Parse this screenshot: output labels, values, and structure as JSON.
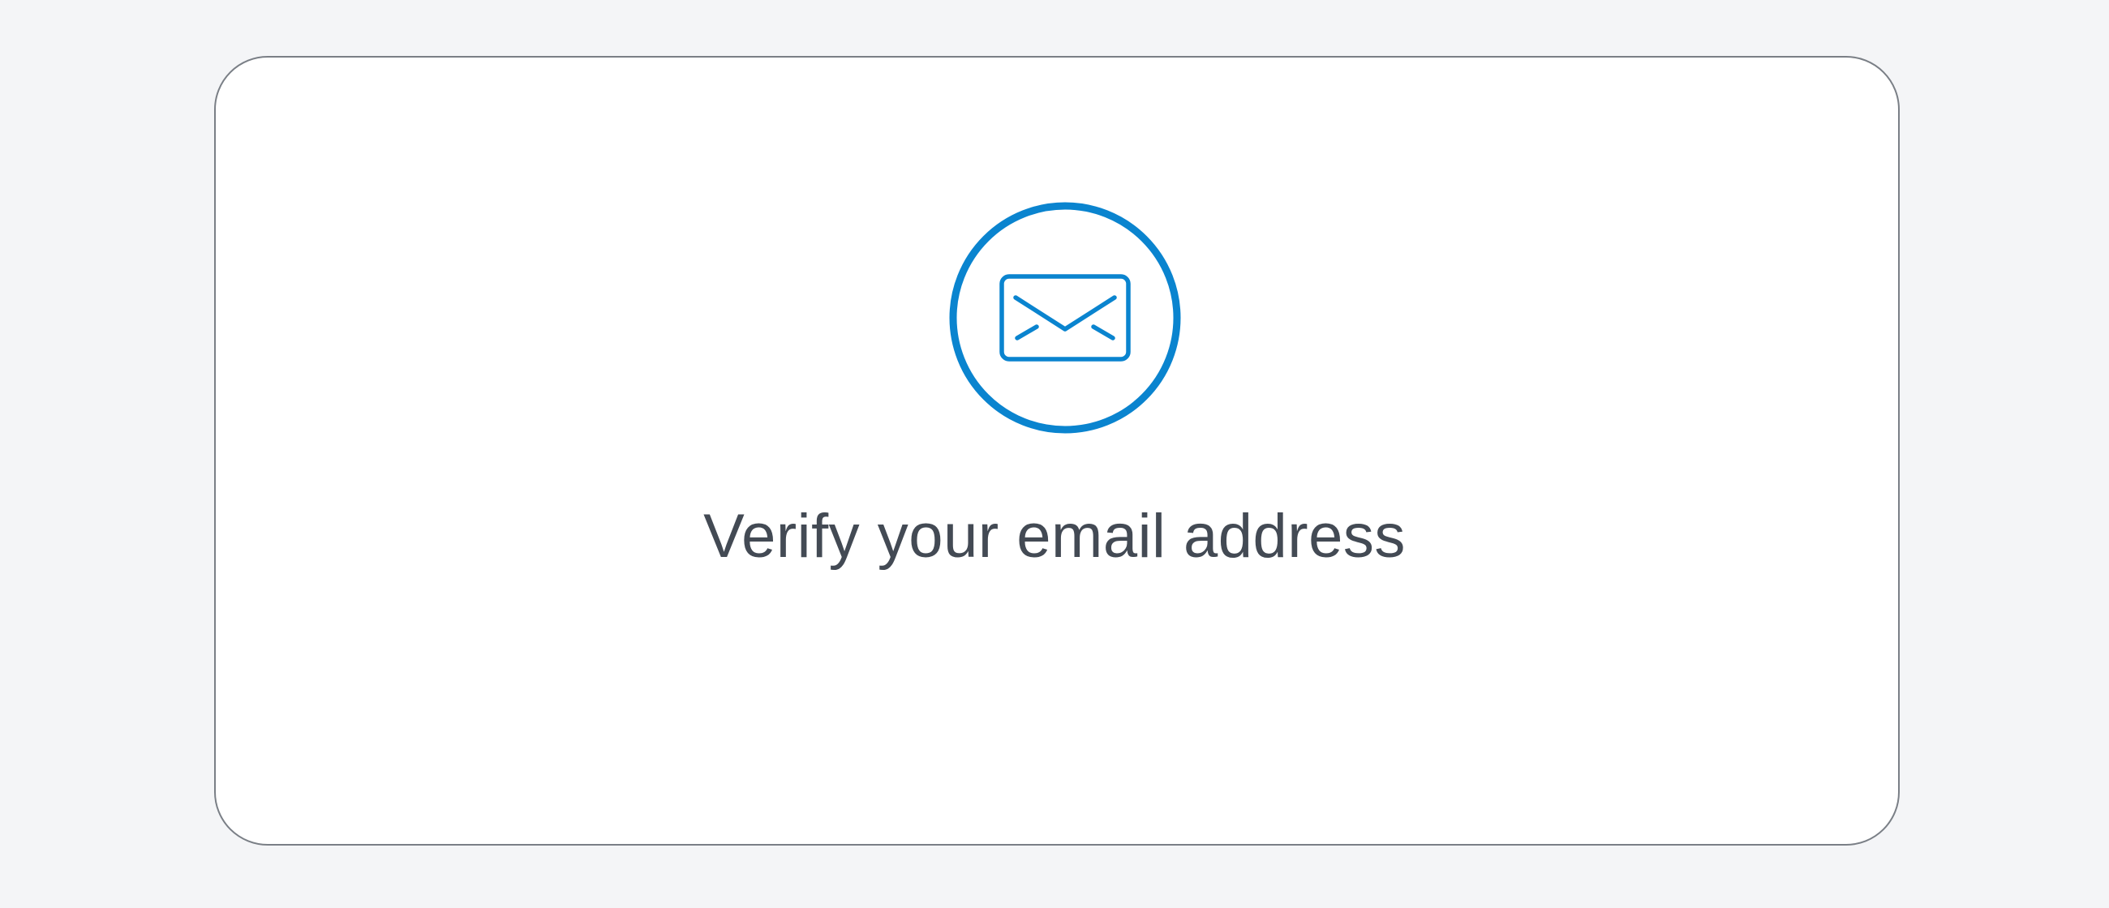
{
  "verify_card": {
    "icon": "envelope-icon",
    "title": "Verify your email address"
  },
  "colors": {
    "page_background": "#f4f5f7",
    "card_background": "#ffffff",
    "card_border": "#7a7f86",
    "accent": "#0a84cf",
    "title_text": "#434a54"
  }
}
